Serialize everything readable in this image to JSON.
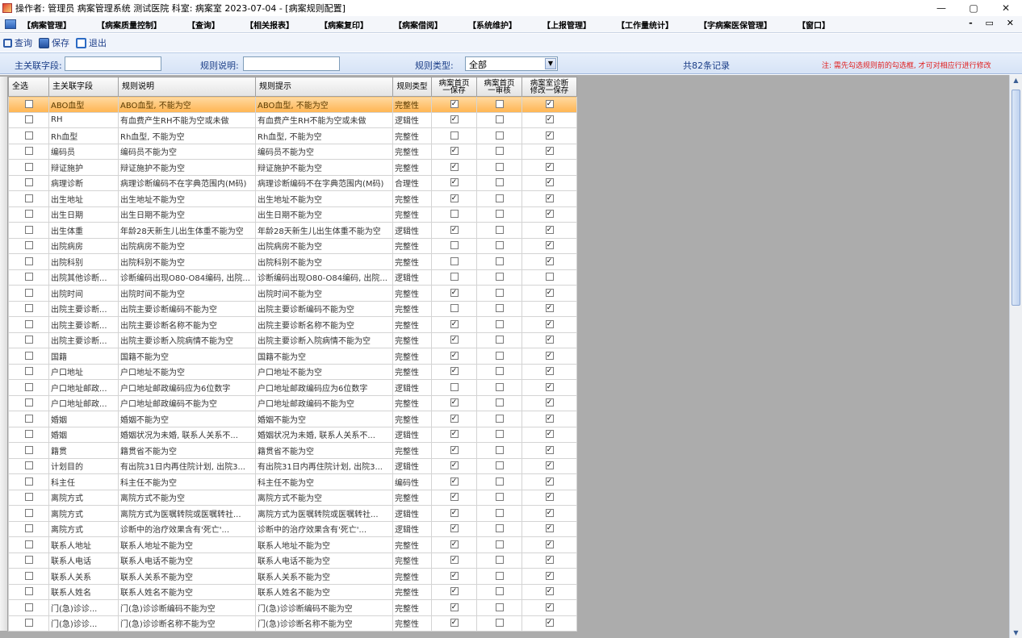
{
  "window": {
    "title": "操作者: 管理员 病案管理系统 测试医院 科室: 病案室 2023-07-04 - [病案规则配置]",
    "controls": [
      "—",
      "▢",
      "✕"
    ]
  },
  "menu": {
    "items": [
      "【病案管理】",
      "【病案质量控制】",
      "【查询】",
      "【相关报表】",
      "【病案复印】",
      "【病案借阅】",
      "【系统维护】",
      "【上报管理】",
      "【工作量统计】",
      "【字病案医保管理】",
      "【窗口】"
    ],
    "mdi_controls": "- ▭ ✕"
  },
  "toolbar": {
    "query_label": "查询",
    "save_label": "保存",
    "exit_label": "退出"
  },
  "filter": {
    "field_label": "主关联字段:",
    "field_value": "",
    "desc_label": "规则说明:",
    "desc_value": "",
    "type_label": "规则类型:",
    "type_selected": "全部",
    "count_text": "共82条记录",
    "note": "注: 需先勾选规则前的勾选框, 才可对相应行进行修改"
  },
  "grid": {
    "headers": {
      "select_all": "全选",
      "field": "主关联字段",
      "desc": "规则说明",
      "hint": "规则提示",
      "type": "规则类型",
      "c1a": "病案首页",
      "c1b": "一保存",
      "c2a": "病案首页",
      "c2b": "一审核",
      "c3a": "病案室诊断",
      "c3b": "修改一保存"
    },
    "rows": [
      {
        "f": "ABO血型",
        "d": "ABO血型, 不能为空",
        "h": "ABO血型, 不能为空",
        "t": "完整性",
        "c1": true,
        "c2": false,
        "c3": true
      },
      {
        "f": "RH",
        "d": "有血费产生RH不能为空或未做",
        "h": "有血费产生RH不能为空或未做",
        "t": "逻辑性",
        "c1": true,
        "c2": false,
        "c3": true
      },
      {
        "f": "Rh血型",
        "d": "Rh血型, 不能为空",
        "h": "Rh血型, 不能为空",
        "t": "完整性",
        "c1": false,
        "c2": false,
        "c3": true
      },
      {
        "f": "编码员",
        "d": "编码员不能为空",
        "h": "编码员不能为空",
        "t": "完整性",
        "c1": true,
        "c2": false,
        "c3": true
      },
      {
        "f": "辩证施护",
        "d": "辩证施护不能为空",
        "h": "辩证施护不能为空",
        "t": "完整性",
        "c1": true,
        "c2": false,
        "c3": true
      },
      {
        "f": "病理诊断",
        "d": "病理诊断编码不在字典范围内(M码)",
        "h": "病理诊断编码不在字典范围内(M码)",
        "t": "合理性",
        "c1": true,
        "c2": false,
        "c3": true
      },
      {
        "f": "出生地址",
        "d": "出生地址不能为空",
        "h": "出生地址不能为空",
        "t": "完整性",
        "c1": true,
        "c2": false,
        "c3": true
      },
      {
        "f": "出生日期",
        "d": "出生日期不能为空",
        "h": "出生日期不能为空",
        "t": "完整性",
        "c1": false,
        "c2": false,
        "c3": true
      },
      {
        "f": "出生体重",
        "d": "年龄28天新生儿出生体重不能为空",
        "h": "年龄28天新生儿出生体重不能为空",
        "t": "逻辑性",
        "c1": true,
        "c2": false,
        "c3": true
      },
      {
        "f": "出院病房",
        "d": "出院病房不能为空",
        "h": "出院病房不能为空",
        "t": "完整性",
        "c1": false,
        "c2": false,
        "c3": true
      },
      {
        "f": "出院科别",
        "d": "出院科别不能为空",
        "h": "出院科别不能为空",
        "t": "完整性",
        "c1": false,
        "c2": false,
        "c3": true
      },
      {
        "f": "出院其他诊断...",
        "d": "诊断编码出现O80-O84编码, 出院...",
        "h": "诊断编码出现O80-O84编码, 出院...",
        "t": "逻辑性",
        "c1": false,
        "c2": false,
        "c3": false
      },
      {
        "f": "出院时间",
        "d": "出院时间不能为空",
        "h": "出院时间不能为空",
        "t": "完整性",
        "c1": true,
        "c2": false,
        "c3": true
      },
      {
        "f": "出院主要诊断...",
        "d": "出院主要诊断编码不能为空",
        "h": "出院主要诊断编码不能为空",
        "t": "完整性",
        "c1": false,
        "c2": false,
        "c3": true
      },
      {
        "f": "出院主要诊断...",
        "d": "出院主要诊断名称不能为空",
        "h": "出院主要诊断名称不能为空",
        "t": "完整性",
        "c1": true,
        "c2": false,
        "c3": true
      },
      {
        "f": "出院主要诊断...",
        "d": "出院主要诊断入院病情不能为空",
        "h": "出院主要诊断入院病情不能为空",
        "t": "完整性",
        "c1": true,
        "c2": false,
        "c3": true
      },
      {
        "f": "国籍",
        "d": "国籍不能为空",
        "h": "国籍不能为空",
        "t": "完整性",
        "c1": true,
        "c2": false,
        "c3": true
      },
      {
        "f": "户口地址",
        "d": "户口地址不能为空",
        "h": "户口地址不能为空",
        "t": "完整性",
        "c1": true,
        "c2": false,
        "c3": true
      },
      {
        "f": "户口地址邮政...",
        "d": "户口地址邮政编码应为6位数字",
        "h": "户口地址邮政编码应为6位数字",
        "t": "逻辑性",
        "c1": false,
        "c2": false,
        "c3": true
      },
      {
        "f": "户口地址邮政...",
        "d": "户口地址邮政编码不能为空",
        "h": "户口地址邮政编码不能为空",
        "t": "完整性",
        "c1": true,
        "c2": false,
        "c3": true
      },
      {
        "f": "婚姻",
        "d": "婚姻不能为空",
        "h": "婚姻不能为空",
        "t": "完整性",
        "c1": true,
        "c2": false,
        "c3": true
      },
      {
        "f": "婚姻",
        "d": "婚姻状况为未婚, 联系人关系不...",
        "h": "婚姻状况为未婚, 联系人关系不...",
        "t": "逻辑性",
        "c1": true,
        "c2": false,
        "c3": true
      },
      {
        "f": "籍贯",
        "d": "籍贯省不能为空",
        "h": "籍贯省不能为空",
        "t": "完整性",
        "c1": true,
        "c2": false,
        "c3": true
      },
      {
        "f": "计划目的",
        "d": "有出院31日内再住院计划, 出院3...",
        "h": "有出院31日内再住院计划, 出院3...",
        "t": "逻辑性",
        "c1": true,
        "c2": false,
        "c3": true
      },
      {
        "f": "科主任",
        "d": "科主任不能为空",
        "h": "科主任不能为空",
        "t": "编码性",
        "c1": true,
        "c2": false,
        "c3": true
      },
      {
        "f": "离院方式",
        "d": "离院方式不能为空",
        "h": "离院方式不能为空",
        "t": "完整性",
        "c1": true,
        "c2": false,
        "c3": true
      },
      {
        "f": "离院方式",
        "d": "离院方式为医嘱转院或医嘱转社...",
        "h": "离院方式为医嘱转院或医嘱转社...",
        "t": "逻辑性",
        "c1": true,
        "c2": false,
        "c3": true
      },
      {
        "f": "离院方式",
        "d": "诊断中的治疗效果含有'死亡'...",
        "h": "诊断中的治疗效果含有'死亡'...",
        "t": "逻辑性",
        "c1": true,
        "c2": false,
        "c3": true
      },
      {
        "f": "联系人地址",
        "d": "联系人地址不能为空",
        "h": "联系人地址不能为空",
        "t": "完整性",
        "c1": true,
        "c2": false,
        "c3": true
      },
      {
        "f": "联系人电话",
        "d": "联系人电话不能为空",
        "h": "联系人电话不能为空",
        "t": "完整性",
        "c1": true,
        "c2": false,
        "c3": true
      },
      {
        "f": "联系人关系",
        "d": "联系人关系不能为空",
        "h": "联系人关系不能为空",
        "t": "完整性",
        "c1": true,
        "c2": false,
        "c3": true
      },
      {
        "f": "联系人姓名",
        "d": "联系人姓名不能为空",
        "h": "联系人姓名不能为空",
        "t": "完整性",
        "c1": true,
        "c2": false,
        "c3": true
      },
      {
        "f": "门(急)诊诊...",
        "d": "门(急)诊诊断编码不能为空",
        "h": "门(急)诊诊断编码不能为空",
        "t": "完整性",
        "c1": true,
        "c2": false,
        "c3": true
      },
      {
        "f": "门(急)诊诊...",
        "d": "门(急)诊诊断名称不能为空",
        "h": "门(急)诊诊断名称不能为空",
        "t": "完整性",
        "c1": true,
        "c2": false,
        "c3": true
      }
    ]
  },
  "colors": {
    "selected_row": "#ffb552",
    "grid_background": "#acacac",
    "note_red": "#e02020",
    "label_blue": "#1a3d87"
  }
}
